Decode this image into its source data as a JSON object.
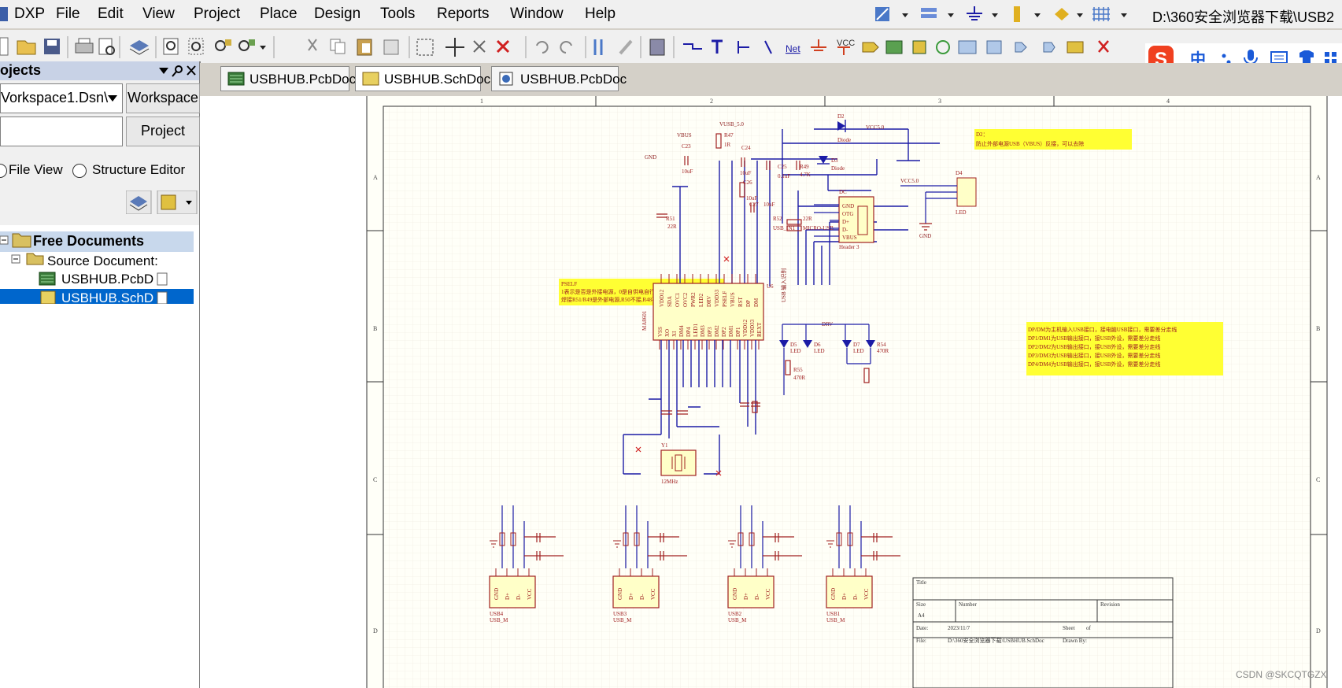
{
  "menu": {
    "app": "DXP",
    "items": [
      {
        "label": "File",
        "key": "F"
      },
      {
        "label": "Edit",
        "key": "E"
      },
      {
        "label": "View",
        "key": "V"
      },
      {
        "label": "Project",
        "key": "c"
      },
      {
        "label": "Place",
        "key": "P"
      },
      {
        "label": "Design",
        "key": "D"
      },
      {
        "label": "Tools",
        "key": "T"
      },
      {
        "label": "Reports",
        "key": "R"
      },
      {
        "label": "Window",
        "key": "W"
      },
      {
        "label": "Help",
        "key": "H"
      }
    ],
    "path": "D:\\360安全浏览器下载\\USB2"
  },
  "ime": {
    "label": "中"
  },
  "panel": {
    "title": "ojects",
    "workspace_value": "Vorkspace1.Dsn\\",
    "workspace_button": "Workspace",
    "project_button": "Project",
    "radio_file_view": "File View",
    "radio_structure": "Structure Editor",
    "tree": {
      "root": "Free Documents",
      "group": "Source Document:",
      "items": [
        "USBHUB.PcbD",
        "USBHUB.SchD"
      ]
    }
  },
  "tabs": [
    "USBHUB.PcbDoc",
    "USBHUB.SchDoc",
    "USBHUB.PcbDoc"
  ],
  "schematic": {
    "col_labels": [
      "1",
      "2",
      "3",
      "4"
    ],
    "row_labels": [
      "A",
      "B",
      "C",
      "D"
    ],
    "chip_name": "MA8601",
    "chip_ref": "U6",
    "chip_top_pins": [
      "VDD12",
      "SDA",
      "OVC1",
      "OVC2",
      "PWR2",
      "LED2",
      "DRV",
      "VDD33",
      "PSELF",
      "VBUS",
      "RST",
      "DP",
      "DM"
    ],
    "chip_bottom_pins": [
      "VSS",
      "XO",
      "XI",
      "DM4",
      "DP4",
      "LED1",
      "DM3",
      "DP3",
      "DM2",
      "DP2",
      "DM1",
      "DP1",
      "VDD12",
      "VDD33",
      "REXT"
    ],
    "net_labels": [
      "VBUS",
      "VUSB_5.0",
      "VCC5.0",
      "GND",
      "DRV",
      "USB 输入识别",
      "DP1",
      "DM1"
    ],
    "comps": [
      {
        "ref": "D2",
        "val": "Diode"
      },
      {
        "ref": "D3",
        "val": "Diode"
      },
      {
        "ref": "R47",
        "val": "1R"
      },
      {
        "ref": "C22",
        "val": "10uF"
      },
      {
        "ref": "C23",
        "val": "10uF"
      },
      {
        "ref": "C24",
        "val": "10uF"
      },
      {
        "ref": "C25",
        "val": "0.1uF"
      },
      {
        "ref": "R49",
        "val": "4.7K"
      },
      {
        "ref": "C26",
        "val": "10uF"
      },
      {
        "ref": "C27",
        "val": "10uF"
      },
      {
        "ref": "R51",
        "val": "22R"
      },
      {
        "ref": "R52",
        "val": "22R"
      },
      {
        "ref": "USB_IN1",
        "val": "MICRO-USB"
      },
      {
        "ref": "DC",
        "val": "Header 3"
      },
      {
        "ref": "Y1",
        "val": "12MHz"
      },
      {
        "ref": "D4",
        "val": "LED"
      },
      {
        "ref": "D5",
        "val": "LED"
      },
      {
        "ref": "D6",
        "val": "LED"
      },
      {
        "ref": "D7",
        "val": "LED"
      },
      {
        "ref": "R54",
        "val": "470R"
      },
      {
        "ref": "R55",
        "val": "470R"
      }
    ],
    "usb_in_pins": [
      "GND",
      "OTG",
      "D+",
      "D-",
      "VBUS"
    ],
    "usb_out": [
      {
        "ref": "USB4",
        "val": "USB_M"
      },
      {
        "ref": "USB3",
        "val": "USB_M"
      },
      {
        "ref": "USB2",
        "val": "USB_M"
      },
      {
        "ref": "USB1",
        "val": "USB_M"
      }
    ],
    "usb_out_pins": [
      "GND",
      "D+",
      "D-",
      "VCC"
    ],
    "note1": {
      "title": "D2：",
      "text": "防止外部电源USB（VBUS）反接，可以去除"
    },
    "note2": {
      "title": "PSELF",
      "lines": [
        "1表示是否是外接电源，0是自供电自行",
        "焊接R51/R49是外部电源,R50不接,R48不接"
      ]
    },
    "note3": {
      "lines": [
        "DP/DM为主机输入USB接口，接电脑USB接口，需要差分走线",
        "DP1/DM1为USB输出接口，接USB外设，需要差分走线",
        "DP2/DM2为USB输出接口，接USB外设，需要差分走线",
        "DP3/DM3为USB输出接口，接USB外设，需要差分走线",
        "DP4/DM4为USB输出接口，接USB外设，需要差分走线"
      ]
    },
    "title_block": {
      "title": "Title",
      "size": "Size",
      "size_val": "A4",
      "number": "Number",
      "revision": "Revision",
      "date": "Date:",
      "date_val": "2023/11/7",
      "sheet": "Sheet",
      "of": "of",
      "file": "File:",
      "file_val": "D:\\360安全浏览器下载\\USBHUB.SchDoc",
      "drawn": "Drawn By:"
    }
  },
  "watermark": "CSDN @SKCQTGZX",
  "colors": {
    "wire": "#1c1ca6",
    "comp": "#a02020",
    "label": "#8b1a1a",
    "note": "#ffff33"
  }
}
